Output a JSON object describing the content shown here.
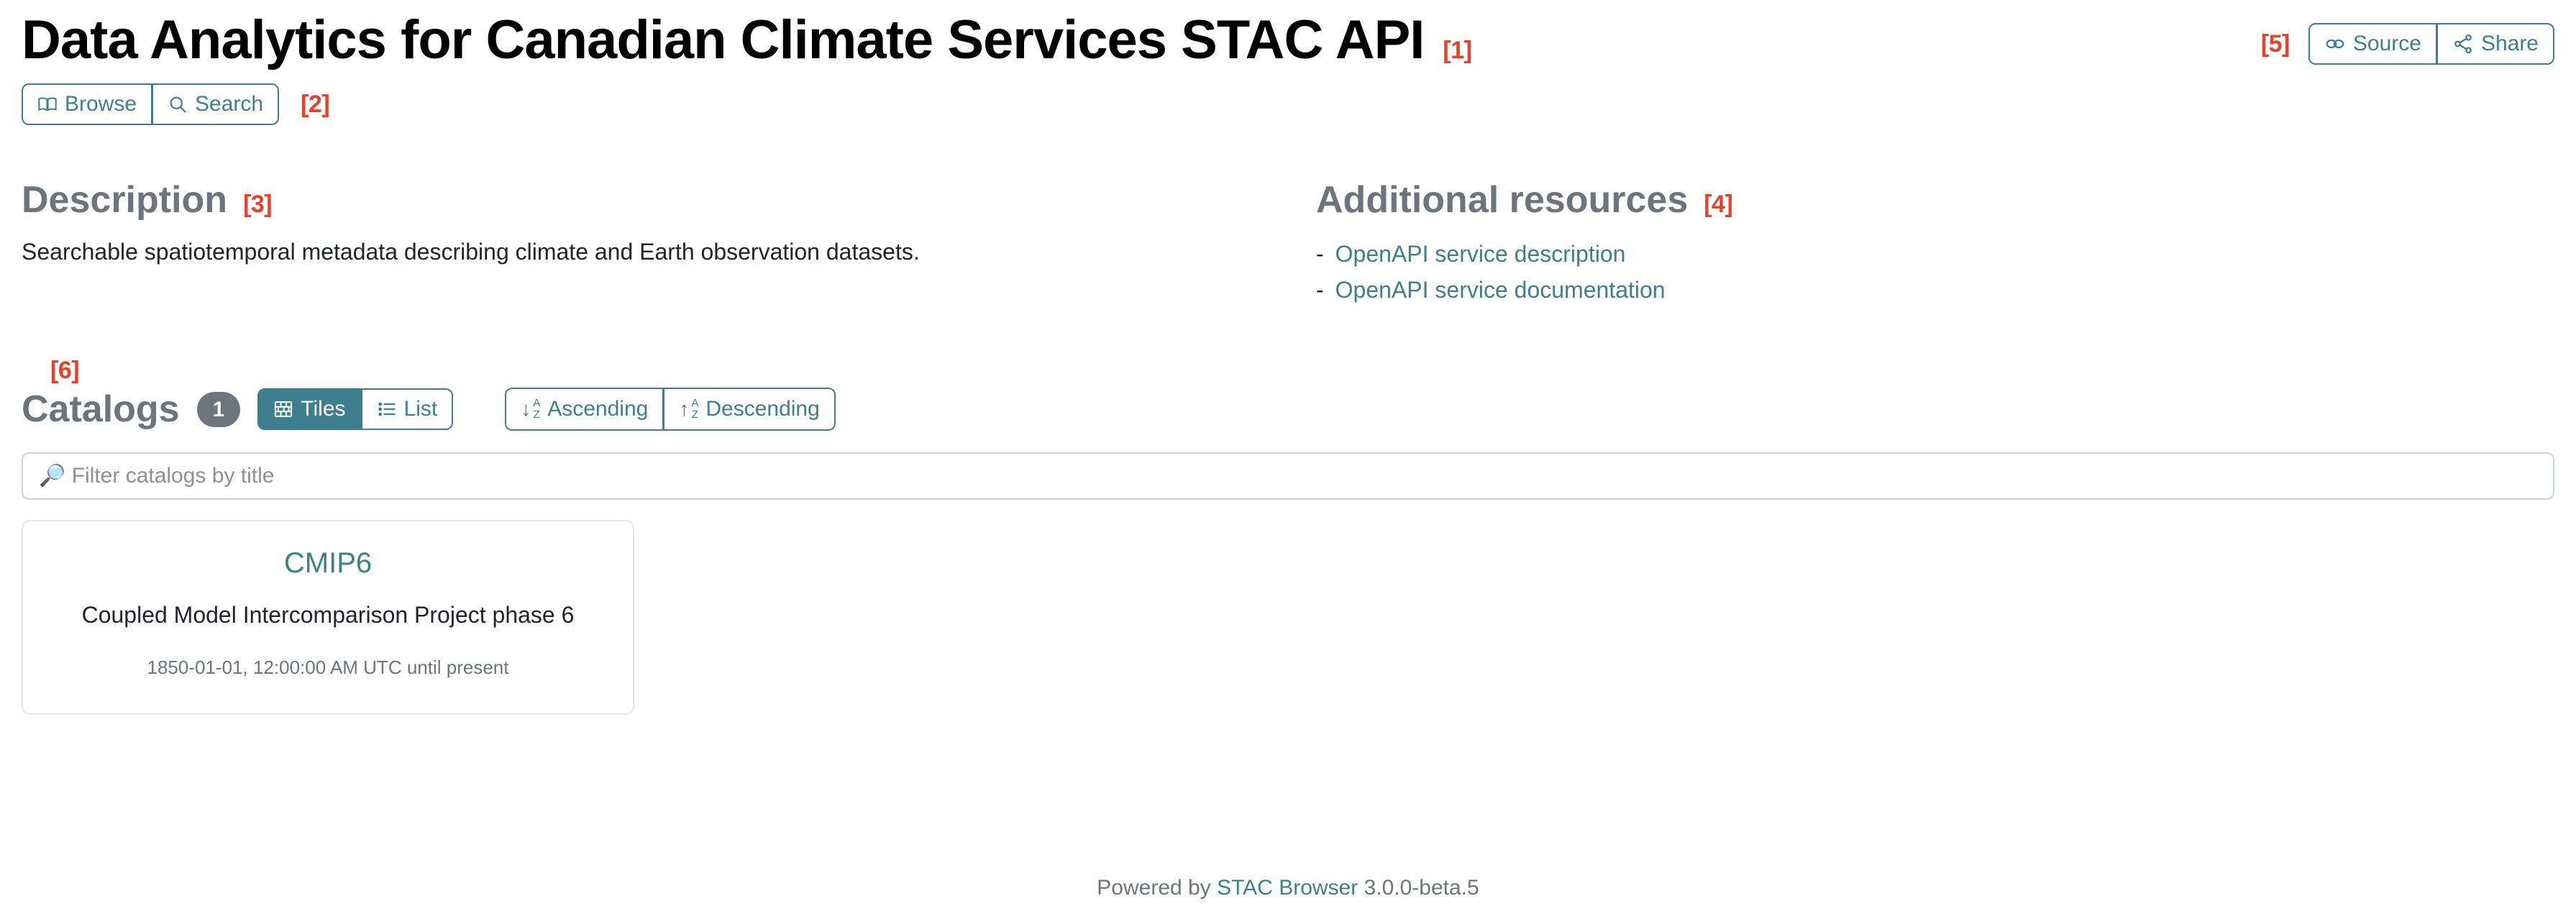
{
  "header": {
    "title": "Data Analytics for Canadian Climate Services STAC API",
    "annotation": "[1]",
    "right_annotation": "[5]",
    "source_label": "Source",
    "share_label": "Share"
  },
  "tabs": {
    "annotation": "[2]",
    "items": [
      {
        "label": "Browse",
        "icon": "book-icon",
        "active": false
      },
      {
        "label": "Search",
        "icon": "search-icon",
        "active": false
      }
    ]
  },
  "description": {
    "heading": "Description",
    "annotation": "[3]",
    "text": "Searchable spatiotemporal metadata describing climate and Earth observation datasets."
  },
  "resources": {
    "heading": "Additional resources",
    "annotation": "[4]",
    "bullet": "-",
    "items": [
      {
        "label": "OpenAPI service description"
      },
      {
        "label": "OpenAPI service documentation"
      }
    ]
  },
  "catalogs": {
    "annotation": "[6]",
    "heading": "Catalogs",
    "count": "1",
    "view_buttons": [
      {
        "label": "Tiles",
        "icon": "tiles-icon",
        "active": true
      },
      {
        "label": "List",
        "icon": "list-icon",
        "active": false
      }
    ],
    "sort_buttons": [
      {
        "label": "Ascending",
        "icon": "sort-ascending-icon",
        "active": false
      },
      {
        "label": "Descending",
        "icon": "sort-descending-icon",
        "active": false
      }
    ],
    "filter": {
      "value": "",
      "placeholder": "🔎 Filter catalogs by title"
    },
    "cards": [
      {
        "title": "CMIP6",
        "description": "Coupled Model Intercomparison Project phase 6",
        "meta": "1850-01-01, 12:00:00 AM UTC until present"
      }
    ]
  },
  "footer": {
    "prefix": "Powered by",
    "link": "STAC Browser",
    "version": "3.0.0-beta.5"
  },
  "colors": {
    "accent": "#3d7f8e",
    "annotation": "#e8402a",
    "muted": "#6c757d",
    "border": "#ced4da"
  }
}
